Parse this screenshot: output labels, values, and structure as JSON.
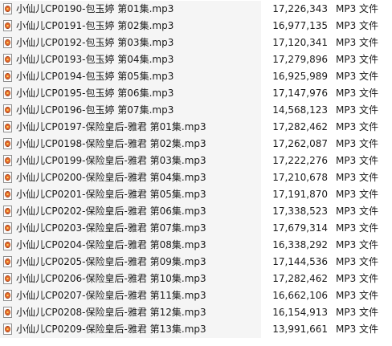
{
  "icon": "mp3-audio-file-icon",
  "files": [
    {
      "name": "小仙儿CP0190-包玉婷 第01集.mp3",
      "size": "17,226,343",
      "type": "MP3 文件"
    },
    {
      "name": "小仙儿CP0191-包玉婷 第02集.mp3",
      "size": "16,977,135",
      "type": "MP3 文件"
    },
    {
      "name": "小仙儿CP0192-包玉婷 第03集.mp3",
      "size": "17,120,341",
      "type": "MP3 文件"
    },
    {
      "name": "小仙儿CP0193-包玉婷 第04集.mp3",
      "size": "17,279,896",
      "type": "MP3 文件"
    },
    {
      "name": "小仙儿CP0194-包玉婷 第05集.mp3",
      "size": "16,925,989",
      "type": "MP3 文件"
    },
    {
      "name": "小仙儿CP0195-包玉婷 第06集.mp3",
      "size": "17,147,976",
      "type": "MP3 文件"
    },
    {
      "name": "小仙儿CP0196-包玉婷 第07集.mp3",
      "size": "14,568,123",
      "type": "MP3 文件"
    },
    {
      "name": "小仙儿CP0197-保险皇后-雅君 第01集.mp3",
      "size": "17,282,462",
      "type": "MP3 文件"
    },
    {
      "name": "小仙儿CP0198-保险皇后-雅君 第02集.mp3",
      "size": "17,262,087",
      "type": "MP3 文件"
    },
    {
      "name": "小仙儿CP0199-保险皇后-雅君 第03集.mp3",
      "size": "17,222,276",
      "type": "MP3 文件"
    },
    {
      "name": "小仙儿CP0200-保险皇后-雅君 第04集.mp3",
      "size": "17,210,678",
      "type": "MP3 文件"
    },
    {
      "name": "小仙儿CP0201-保险皇后-雅君 第05集.mp3",
      "size": "17,191,870",
      "type": "MP3 文件"
    },
    {
      "name": "小仙儿CP0202-保险皇后-雅君 第06集.mp3",
      "size": "17,338,523",
      "type": "MP3 文件"
    },
    {
      "name": "小仙儿CP0203-保险皇后-雅君 第07集.mp3",
      "size": "17,679,314",
      "type": "MP3 文件"
    },
    {
      "name": "小仙儿CP0204-保险皇后-雅君 第08集.mp3",
      "size": "16,338,292",
      "type": "MP3 文件"
    },
    {
      "name": "小仙儿CP0205-保险皇后-雅君 第09集.mp3",
      "size": "17,144,536",
      "type": "MP3 文件"
    },
    {
      "name": "小仙儿CP0206-保险皇后-雅君 第10集.mp3",
      "size": "17,282,462",
      "type": "MP3 文件"
    },
    {
      "name": "小仙儿CP0207-保险皇后-雅君 第11集.mp3",
      "size": "16,662,106",
      "type": "MP3 文件"
    },
    {
      "name": "小仙儿CP0208-保险皇后-雅君 第12集.mp3",
      "size": "16,154,913",
      "type": "MP3 文件"
    },
    {
      "name": "小仙儿CP0209-保险皇后-雅君 第13集.mp3",
      "size": "13,991,661",
      "type": "MP3 文件"
    }
  ]
}
